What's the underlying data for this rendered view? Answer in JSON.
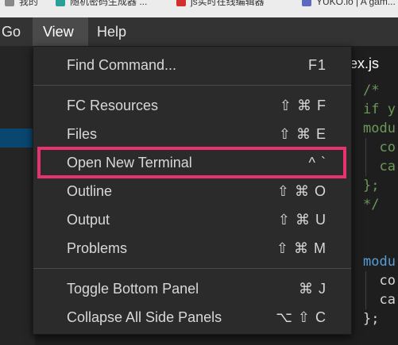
{
  "bookmarks": [
    {
      "label": "我的",
      "icon": "folder-icon",
      "color": "#888888"
    },
    {
      "label": "随机密码生成器 ...",
      "icon": "bookmark-favicon",
      "color": "#2aa198"
    },
    {
      "label": "js实时在线编辑器",
      "icon": "bookmark-favicon",
      "color": "#d32f2f"
    },
    {
      "label": "YUKO.io | A gam...",
      "icon": "bookmark-favicon",
      "color": "#5c6bc0"
    }
  ],
  "menubar": {
    "items": [
      {
        "label": "Go"
      },
      {
        "label": "View"
      },
      {
        "label": "Help"
      }
    ]
  },
  "editor": {
    "tab_label": "ex.js",
    "code_lines": [
      {
        "text": "/*",
        "color": "#6a9955"
      },
      {
        "text": "if y",
        "color": "#6a9955"
      },
      {
        "text": "modu",
        "color": "#6a9955"
      },
      {
        "text": "  co",
        "color": "#6a9955"
      },
      {
        "text": "  ca",
        "color": "#6a9955"
      },
      {
        "text": "};",
        "color": "#6a9955"
      },
      {
        "text": "*/",
        "color": "#6a9955"
      },
      {
        "text": "",
        "color": "#d4d4d4"
      },
      {
        "text": "modu",
        "color": "#569cd6"
      },
      {
        "text": "  co",
        "color": "#d4d4d4"
      },
      {
        "text": "  ca",
        "color": "#d4d4d4"
      },
      {
        "text": "};",
        "color": "#d4d4d4"
      }
    ]
  },
  "view_menu": {
    "groups": [
      [
        {
          "label": "Find Command...",
          "shortcut": "F1"
        }
      ],
      [
        {
          "label": "FC Resources",
          "shortcut": "⇧ ⌘ F"
        },
        {
          "label": "Files",
          "shortcut": "⇧ ⌘ E"
        },
        {
          "label": "Open New Terminal",
          "shortcut": "^ `"
        },
        {
          "label": "Outline",
          "shortcut": "⇧ ⌘ O"
        },
        {
          "label": "Output",
          "shortcut": "⇧ ⌘ U"
        },
        {
          "label": "Problems",
          "shortcut": "⇧ ⌘ M"
        }
      ],
      [
        {
          "label": "Toggle Bottom Panel",
          "shortcut": "⌘ J"
        },
        {
          "label": "Collapse All Side Panels",
          "shortcut": "⌥ ⇧ C"
        }
      ]
    ],
    "highlight_color": "#e8326d"
  }
}
